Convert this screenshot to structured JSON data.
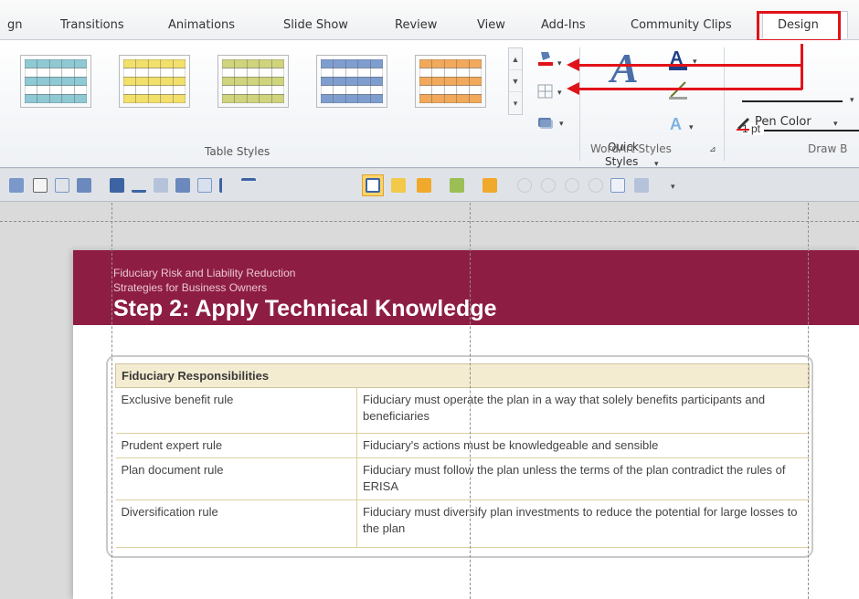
{
  "tabs": [
    "gn",
    "Transitions",
    "Animations",
    "Slide Show",
    "Review",
    "View",
    "Add-Ins",
    "Community Clips",
    "Design"
  ],
  "ribbon": {
    "table_styles_label": "Table Styles",
    "wordart_styles_label": "WordArt Styles",
    "quick_styles_line1": "Quick",
    "quick_styles_line2": "Styles",
    "pen_weight": "1 pt",
    "pen_color_label": "Pen Color",
    "draw_borders_label": "Draw B",
    "swatch_colors": [
      "#8ec9d4",
      "#f2e06b",
      "#cfd47d",
      "#7f9ed0",
      "#f2a95b"
    ]
  },
  "slide": {
    "subtitle_line1": "Fiduciary Risk and Liability Reduction",
    "subtitle_line2": "Strategies for Business Owners",
    "title": "Step 2: Apply Technical Knowledge",
    "table": {
      "header": "Fiduciary Responsibilities",
      "rows": [
        {
          "rule": "Exclusive benefit rule",
          "description": "Fiduciary must operate the plan in a way that solely benefits participants and beneficiaries"
        },
        {
          "rule": "Prudent expert rule",
          "description": "Fiduciary's actions must be knowledgeable and sensible"
        },
        {
          "rule": "Plan document rule",
          "description": "Fiduciary must follow the plan unless the terms of the plan contradict the rules of ERISA"
        },
        {
          "rule": "Diversification rule",
          "description": "Fiduciary must diversify plan investments to reduce the potential for large losses to the plan"
        }
      ]
    }
  },
  "colors": {
    "banner": "#8e1d44",
    "highlight": "#e1131a",
    "table_header": "#f3ecd0"
  }
}
